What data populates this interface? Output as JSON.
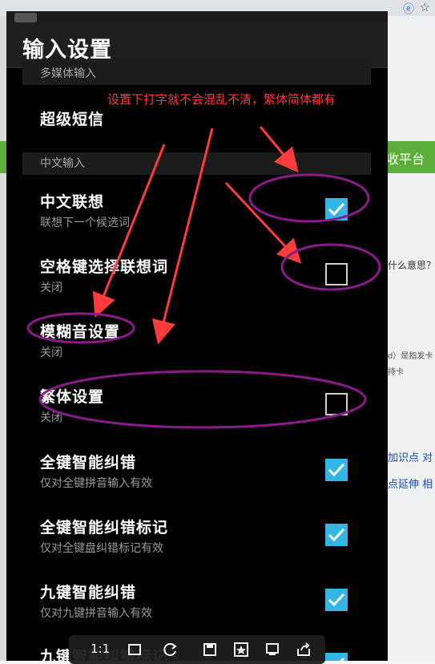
{
  "background_page": {
    "green_bar_text": "收平台",
    "snippets": [
      {
        "text": "什么意思？",
        "top": 0
      },
      {
        "text": "d）是指发卡",
        "top": 0
      },
      {
        "text": "持卡",
        "top": 0
      },
      {
        "text": "加识点 对",
        "top": 0
      },
      {
        "text": "点延伸 相",
        "top": 0
      }
    ]
  },
  "screen": {
    "title": "输入设置",
    "sections": [
      {
        "label": "多媒体输入"
      },
      {
        "label": "中文输入"
      }
    ],
    "items": [
      {
        "label": "超级短信",
        "sub": ""
      },
      {
        "label": "中文联想",
        "sub": "联想下一个候选词",
        "checked": true
      },
      {
        "label": "空格键选择联想词",
        "sub": "关闭",
        "checked": false
      },
      {
        "label": "模糊音设置",
        "sub": "关闭"
      },
      {
        "label": "繁体设置",
        "sub": "关闭",
        "checked": false
      },
      {
        "label": "全键智能纠错",
        "sub": "仅对全键拼音输入有效",
        "checked": true
      },
      {
        "label": "全键智能纠错标记",
        "sub": "仅对全键盘纠错标记有效",
        "checked": true
      },
      {
        "label": "九键智能纠错",
        "sub": "仅对九键拼音输入有效",
        "checked": true
      },
      {
        "label": "九键智能纠错标记",
        "sub": "",
        "checked": true
      }
    ]
  },
  "annotation": {
    "text": "设置下打字就不会混乱不清，繁体简体都有",
    "arrow_color": "#ff3b3b",
    "ellipse_color": "#8b1a8b"
  },
  "viewer_toolbar": {
    "zoom_label": "1:1",
    "icons": [
      "fit-window-icon",
      "rotate-icon",
      "save-icon",
      "favorite-icon",
      "fullscreen-icon",
      "share-icon"
    ]
  },
  "colors": {
    "accent_checkbox": "#33b5e5",
    "screen_bg": "#000000",
    "header_bg": "#1f1f1f"
  }
}
